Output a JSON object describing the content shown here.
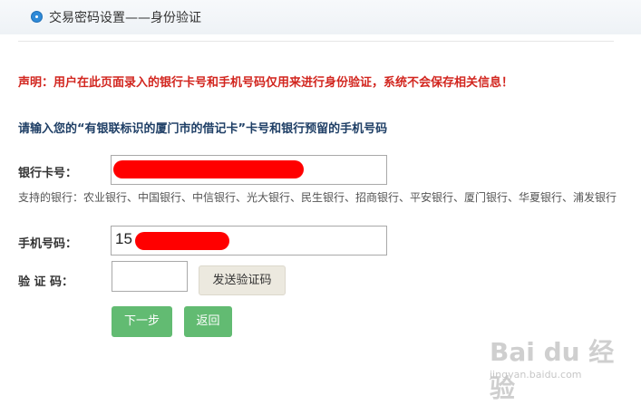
{
  "header": {
    "title": "交易密码设置——身份验证"
  },
  "notice": "声明：用户在此页面录入的银行卡号和手机号码仅用来进行身份验证，系统不会保存相关信息！",
  "instruction": "请输入您的“有银联标识的厦门市的借记卡”卡号和银行预留的手机号码",
  "form": {
    "card_label": "银行卡号：",
    "supported_banks": "支持的银行：农业银行、中国银行、中信银行、光大银行、民生银行、招商银行、平安银行、厦门银行、华夏银行、浦发银行",
    "phone_label": "手机号码：",
    "phone_value": "15",
    "code_label": "验 证 码：",
    "send_code_label": "发送验证码"
  },
  "buttons": {
    "next": "下一步",
    "back": "返回"
  },
  "watermark": {
    "main": "Bai du 经验",
    "sub": "jingyan.baidu.com"
  },
  "colors": {
    "notice": "#d2261f",
    "redaction": "#ff0000",
    "button_green": "#62bb72",
    "instruction": "#1f3f66"
  }
}
